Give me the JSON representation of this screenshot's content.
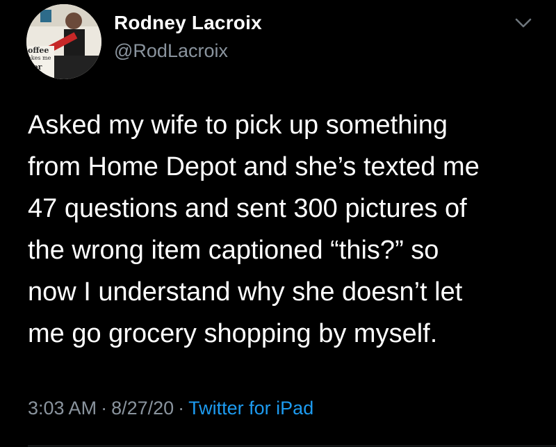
{
  "author": {
    "display_name": "Rodney Lacroix",
    "handle": "@RodLacroix",
    "avatar_icon": "profile-photo-guitarist",
    "avatar_text": [
      "offee",
      "akes me",
      "oor"
    ]
  },
  "tweet": {
    "lines": [
      "Asked my wife to pick up something",
      "from Home Depot and she’s texted me",
      "47 questions and sent 300 pictures of",
      "the wrong item captioned “this?” so",
      "now I understand why she doesn’t let",
      "me go grocery shopping by myself."
    ]
  },
  "meta": {
    "time": "3:03 AM",
    "date": "8/27/20",
    "separator": "·",
    "source": "Twitter for iPad"
  },
  "menu_icon": "chevron-down-icon",
  "colors": {
    "background": "#000000",
    "text": "#ffffff",
    "secondary": "#8a949e",
    "link": "#1d9bf0"
  }
}
